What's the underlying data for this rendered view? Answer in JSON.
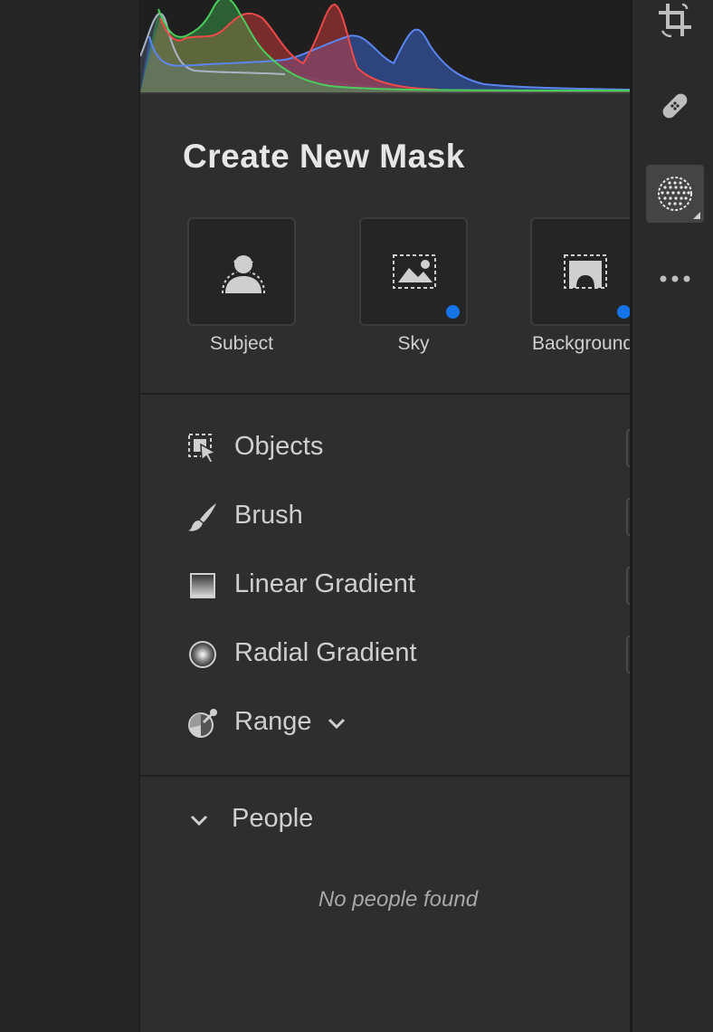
{
  "panel": {
    "title": "Create New Mask",
    "mask_types": [
      {
        "label": "Subject",
        "icon": "subject-icon",
        "badge": false
      },
      {
        "label": "Sky",
        "icon": "sky-icon",
        "badge": true
      },
      {
        "label": "Background",
        "icon": "background-icon",
        "badge": true
      }
    ],
    "tools": [
      {
        "label": "Objects",
        "icon": "objects-icon"
      },
      {
        "label": "Brush",
        "icon": "brush-icon"
      },
      {
        "label": "Linear Gradient",
        "icon": "linear-gradient-icon"
      },
      {
        "label": "Radial Gradient",
        "icon": "radial-gradient-icon"
      },
      {
        "label": "Range",
        "icon": "range-icon",
        "has_dropdown": true
      }
    ],
    "people": {
      "label": "People",
      "empty_message": "No people found"
    }
  },
  "toolstrip": [
    {
      "icon": "crop-icon",
      "active": false
    },
    {
      "icon": "healing-icon",
      "active": false
    },
    {
      "icon": "masking-icon",
      "active": true
    },
    {
      "icon": "more-icon",
      "active": false
    }
  ],
  "colors": {
    "accent_dot": "#1473e6",
    "panel_bg": "#2e2e2e",
    "histogram_red": "#d23a3a",
    "histogram_green": "#3fae4f",
    "histogram_blue": "#3a63c9"
  }
}
